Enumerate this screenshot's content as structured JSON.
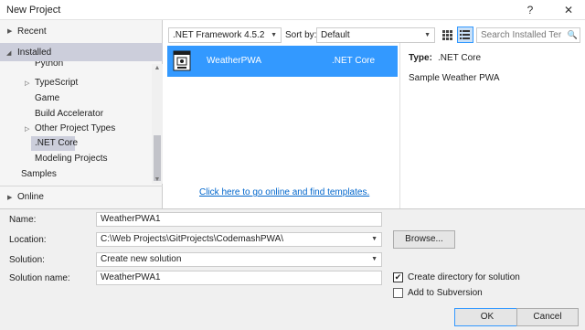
{
  "window": {
    "title": "New Project",
    "help": "?",
    "close": "✕"
  },
  "tree": {
    "recent": "Recent",
    "installed": "Installed",
    "python": "Python",
    "typescript": "TypeScript",
    "game": "Game",
    "build_accelerator": "Build Accelerator",
    "other_project_types": "Other Project Types",
    "net_core": ".NET Core",
    "modeling_projects": "Modeling Projects",
    "samples": "Samples",
    "online": "Online"
  },
  "toolbar": {
    "framework": ".NET Framework 4.5.2",
    "sort_label": "Sort by:",
    "sort_value": "Default",
    "search_placeholder": "Search Installed Ter",
    "search_icon": "🔍"
  },
  "templates": [
    {
      "name": "WeatherPWA",
      "language": ".NET Core"
    }
  ],
  "online_link": "Click here to go online and find templates.",
  "details": {
    "type_label": "Type:",
    "type_value": ".NET Core",
    "description": "Sample Weather PWA"
  },
  "form": {
    "name_label": "Name:",
    "name_value": "WeatherPWA1",
    "location_label": "Location:",
    "location_value": "C:\\Web Projects\\GitProjects\\CodemashPWA\\",
    "solution_label": "Solution:",
    "solution_value": "Create new solution",
    "solution_name_label": "Solution name:",
    "solution_name_value": "WeatherPWA1",
    "browse": "Browse...",
    "create_dir_label": "Create directory for solution",
    "create_dir_checked": true,
    "add_subversion_label": "Add to Subversion",
    "add_subversion_checked": false,
    "ok": "OK",
    "cancel": "Cancel"
  }
}
